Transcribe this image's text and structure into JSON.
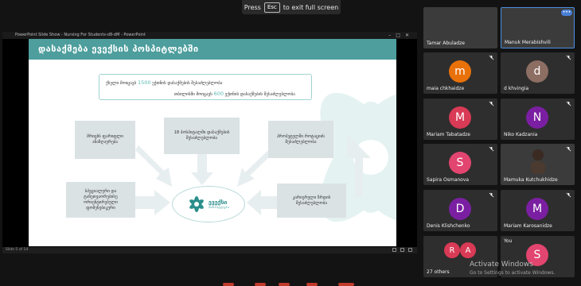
{
  "banner": {
    "press": "Press",
    "key": "Esc",
    "rest": "to exit full screen"
  },
  "powerpoint": {
    "title": "PowerPoint Slide Show  -  Nursing For  Students-d8-dM - PowerPoint",
    "status": "Slide 5 of 14"
  },
  "slide": {
    "header": "დასაქმება ევექსის პოსპიტლებში",
    "topbox": {
      "line1_pre": "ქსელი მოიცავს ",
      "line1_num": "1500",
      "line1_post": " ექთნის დასაქმების შესაძლებლობა",
      "line2_pre": "თბილისში მოიცავს ",
      "line2_num": "600",
      "line2_post": " ექთნის დასაქმების შესაძლებლობა"
    },
    "cards": {
      "top_left": "მრიცხს ფარიფლი ანაზღაურება",
      "top_center": "18 პოსპიტალში დასაქმების შესაძლებლობა",
      "top_right": "პროპეტულში როტაციის შესაძლებლობა",
      "bottom_left": "სპეციალური და ტანეთვაორებისე ორიენტირებული ფომენებიკური",
      "bottom_right": "კარიერული ზრდის შესაძლებლობა"
    },
    "logo": {
      "name": "ევექსი",
      "sub": "ჰოსპიტლები"
    }
  },
  "participants": [
    {
      "name": "Tamar Abuladze",
      "initial": "",
      "color": ""
    },
    {
      "name": "Manuk Merabishvili",
      "initial": "",
      "color": ""
    },
    {
      "name": "maia chkhaidze",
      "initial": "m",
      "color": "#e8710a"
    },
    {
      "name": "d khvingia",
      "initial": "d",
      "color": "#8d6e63"
    },
    {
      "name": "Mariam Tabatadze",
      "initial": "M",
      "color": "#d93a55"
    },
    {
      "name": "Niko Kadzania",
      "initial": "N",
      "color": "#7b1fa2"
    },
    {
      "name": "Sapira Osmanova",
      "initial": "S",
      "color": "#e2456f"
    },
    {
      "name": "Mamuka Kutchukhidze",
      "initial": "",
      "color": ""
    },
    {
      "name": "Denis Klishchenko",
      "initial": "D",
      "color": "#7b1fa2"
    },
    {
      "name": "Mariam Karosanidze",
      "initial": "M",
      "color": "#7b1fa2"
    },
    {
      "name": "27 others",
      "initial": "R",
      "color": "#d93a55",
      "initial2": "A"
    },
    {
      "name": "You",
      "initial": "S",
      "color": "#e2456f"
    }
  ],
  "watermark": {
    "line1": "Activate Windows",
    "line2": "Go to Settings to activate Windows."
  },
  "colors": {
    "accent": "#4d9e9d",
    "card": "#dbe2e4",
    "tile": "#2e2e2e"
  }
}
